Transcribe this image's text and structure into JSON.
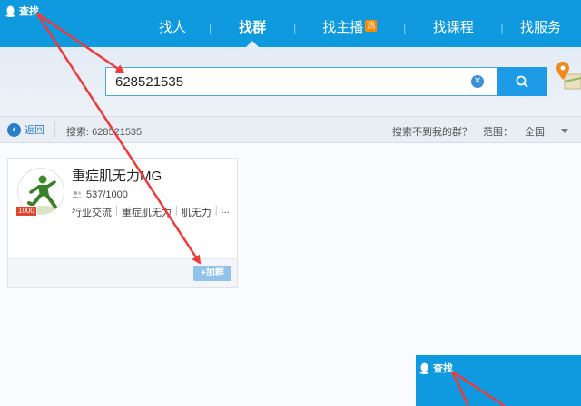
{
  "app": {
    "title": "查找"
  },
  "nav": {
    "tabs": [
      {
        "label": "找人"
      },
      {
        "label": "找群"
      },
      {
        "label": "找主播",
        "badge": "热"
      },
      {
        "label": "找课程"
      },
      {
        "label": "找服务"
      }
    ],
    "separator": "|",
    "active": "找群"
  },
  "search": {
    "value": "628521535",
    "clear_icon": "clear-icon",
    "button_icon": "search-icon"
  },
  "filter": {
    "back_label": "返回",
    "search_text": "搜索: 628521535",
    "not_found": "搜索不到我的群？",
    "range_label": "范围：",
    "range_value": "全国"
  },
  "results": [
    {
      "name": "重症肌无力MG",
      "members": "537/1000",
      "level_badge": "1000",
      "tags": [
        "行业交流",
        "|",
        "重症肌无力",
        "|",
        "肌无力",
        "|",
        "..."
      ],
      "join_label": "+加群"
    }
  ],
  "thumbnail": {
    "title": "查找"
  },
  "colors": {
    "brand": "#0f9ae0",
    "arrow": "#f03a3a",
    "join": "#8fc3ec"
  }
}
